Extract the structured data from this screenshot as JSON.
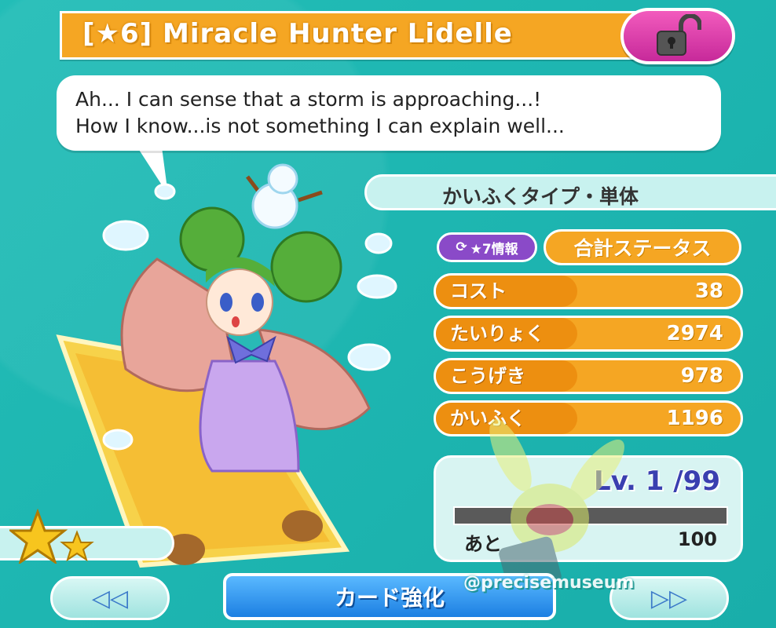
{
  "header": {
    "title": "[★6]  Miracle Hunter Lidelle",
    "lock_icon": "unlocked-padlock-icon"
  },
  "speech": {
    "line1": "Ah... I can sense that a storm is approaching...!",
    "line2": "How I know...is not something I can explain well..."
  },
  "card_type": "かいふくタイプ・単体",
  "stats_panel": {
    "info_button": "★7情報",
    "total_label": "合計ステータス",
    "rows": [
      {
        "label": "コスト",
        "value": "38"
      },
      {
        "label": "たいりょく",
        "value": "2974"
      },
      {
        "label": "こうげき",
        "value": "978"
      },
      {
        "label": "かいふく",
        "value": "1196"
      }
    ]
  },
  "level": {
    "text": "Lv. 1 /99",
    "remaining_label": "あと",
    "remaining_value": "100",
    "progress": 0.0
  },
  "rarity_stars": 2,
  "nav": {
    "prev": "◁◁",
    "next": "▷▷",
    "enhance": "カード強化"
  },
  "watermark": "@precisemuseum",
  "colors": {
    "background": "#1fb8b3",
    "accent_orange": "#f5a623",
    "lock_pink": "#e045b0",
    "enhance_blue": "#1c7fe2"
  }
}
